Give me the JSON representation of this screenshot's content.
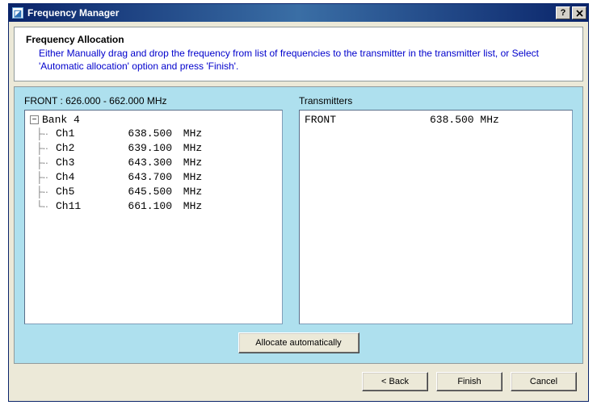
{
  "window": {
    "title": "Frequency Manager",
    "icon_glyph": "◪"
  },
  "header": {
    "title": "Frequency Allocation",
    "description": "Either Manually drag and drop the frequency from list of frequencies to the transmitter in the transmitter list, or Select 'Automatic allocation' option and press 'Finish'."
  },
  "freq_panel": {
    "label": "FRONT : 626.000 - 662.000 MHz",
    "bank_name": "Bank 4",
    "toggle_glyph": "−",
    "channels": [
      {
        "name": "Ch1",
        "freq": "638.500",
        "unit": "MHz"
      },
      {
        "name": "Ch2",
        "freq": "639.100",
        "unit": "MHz"
      },
      {
        "name": "Ch3",
        "freq": "643.300",
        "unit": "MHz"
      },
      {
        "name": "Ch4",
        "freq": "643.700",
        "unit": "MHz"
      },
      {
        "name": "Ch5",
        "freq": "645.500",
        "unit": "MHz"
      },
      {
        "name": "Ch11",
        "freq": "661.100",
        "unit": "MHz"
      }
    ]
  },
  "tx_panel": {
    "label": "Transmitters",
    "items": [
      {
        "name": "FRONT",
        "freq": "638.500 MHz"
      }
    ]
  },
  "buttons": {
    "allocate": "Allocate automatically",
    "back": "< Back",
    "finish": "Finish",
    "cancel": "Cancel"
  }
}
